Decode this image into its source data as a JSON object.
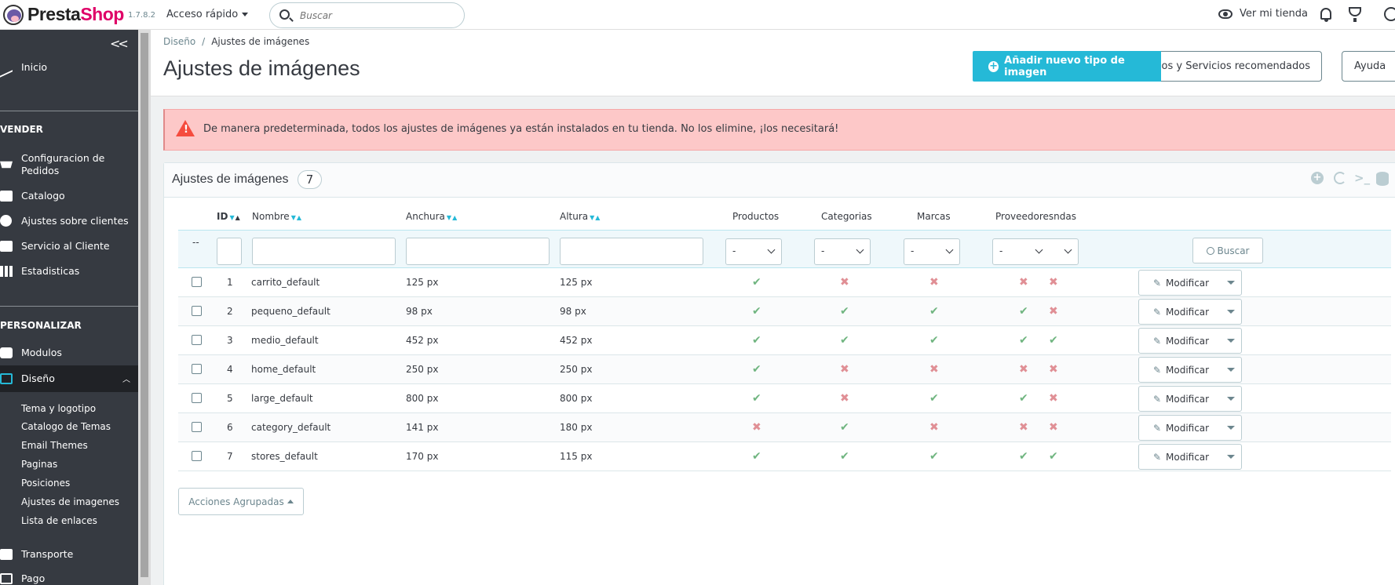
{
  "header": {
    "brand_pre": "Presta",
    "brand_post": "Shop",
    "version": "1.7.8.2",
    "quick_access": "Acceso rápido",
    "search_placeholder": "Buscar",
    "view_store": "Ver mi tienda"
  },
  "sidebar": {
    "collapse": "<<",
    "inicio": "Inicio",
    "section_vender": "VENDER",
    "pedidos_line1": "Configuracion de",
    "pedidos_line2": "Pedidos",
    "catalogo": "Catalogo",
    "clientes": "Ajustes sobre clientes",
    "servicio": "Servicio al Cliente",
    "estadisticas": "Estadisticas",
    "section_personalizar": "PERSONALIZAR",
    "modulos": "Modulos",
    "diseno": "Diseño",
    "sub": [
      "Tema y logotipo",
      "Catalogo de Temas",
      "Email Themes",
      "Paginas",
      "Posiciones",
      "Ajustes de imagenes",
      "Lista de enlaces"
    ],
    "transporte": "Transporte",
    "pago": "Pago"
  },
  "page": {
    "breadcrumb_parent": "Diseño",
    "breadcrumb_sep": "/",
    "breadcrumb_current": "Ajustes de imágenes",
    "title": "Ajustes de imágenes",
    "add_button": "Añadir nuevo tipo de imagen",
    "recommended_button": "Módulos y Servicios recomendados",
    "help_button": "Ayuda"
  },
  "alert": {
    "message": "De manera predeterminada, todos los ajustes de imágenes ya están instalados en tu tienda. No los elimine, ¡los necesitará!"
  },
  "panel": {
    "title": "Ajustes de imágenes",
    "count": "7",
    "columns": {
      "id": "ID",
      "name": "Nombre",
      "width": "Anchura",
      "height": "Altura",
      "products": "Productos",
      "categories": "Categorias",
      "brands": "Marcas",
      "suppliers": "Proveedores",
      "stores_tail": "ndas"
    },
    "filter_dash": "--",
    "select_default": "-",
    "search_button": "Buscar",
    "edit_label": "Modificar",
    "bulk_actions": "Acciones Agrupadas",
    "rows": [
      {
        "id": "1",
        "name": "carrito_default",
        "width": "125 px",
        "height": "125 px",
        "products": true,
        "categories": false,
        "brands": false,
        "suppliers": false,
        "stores": false
      },
      {
        "id": "2",
        "name": "pequeno_default",
        "width": "98 px",
        "height": "98 px",
        "products": true,
        "categories": true,
        "brands": true,
        "suppliers": true,
        "stores": false
      },
      {
        "id": "3",
        "name": "medio_default",
        "width": "452 px",
        "height": "452 px",
        "products": true,
        "categories": true,
        "brands": true,
        "suppliers": true,
        "stores": true
      },
      {
        "id": "4",
        "name": "home_default",
        "width": "250 px",
        "height": "250 px",
        "products": true,
        "categories": false,
        "brands": false,
        "suppliers": false,
        "stores": false
      },
      {
        "id": "5",
        "name": "large_default",
        "width": "800 px",
        "height": "800 px",
        "products": true,
        "categories": false,
        "brands": true,
        "suppliers": true,
        "stores": false
      },
      {
        "id": "6",
        "name": "category_default",
        "width": "141 px",
        "height": "180 px",
        "products": false,
        "categories": true,
        "brands": false,
        "suppliers": false,
        "stores": false
      },
      {
        "id": "7",
        "name": "stores_default",
        "width": "170 px",
        "height": "115 px",
        "products": true,
        "categories": true,
        "brands": true,
        "suppliers": true,
        "stores": true
      }
    ]
  },
  "colors": {
    "accent": "#25b9d7",
    "yes": "#70b580",
    "no": "#e08f95",
    "alert_bg": "#fdc8c8",
    "sidebar_bg": "#363a41"
  }
}
